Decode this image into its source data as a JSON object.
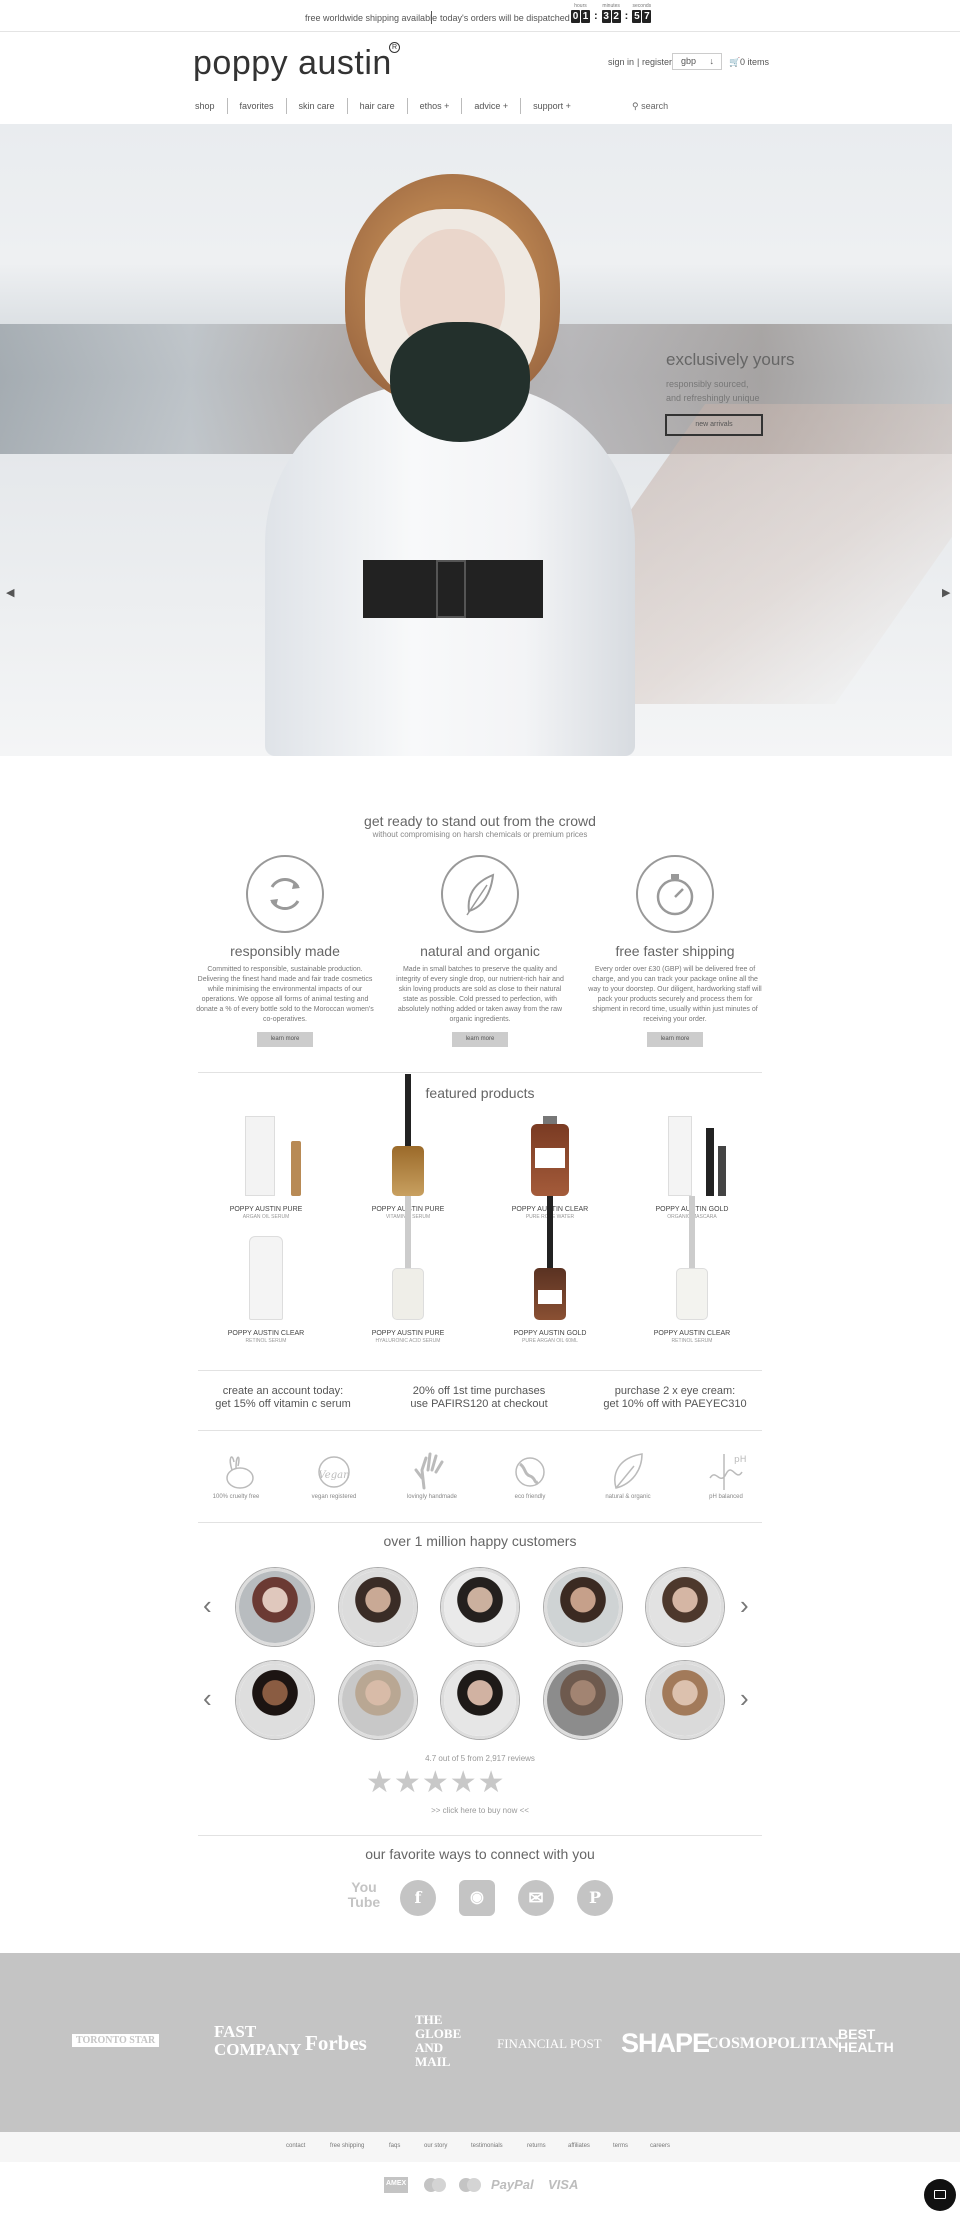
{
  "topbar": {
    "shipping": "free worldwide shipping available",
    "dispatch": "today's orders will be dispatched in",
    "timer": {
      "labels": [
        "hours",
        "minutes",
        "seconds"
      ],
      "hours": [
        "0",
        "1"
      ],
      "minutes": [
        "3",
        "2"
      ],
      "seconds": [
        "5",
        "7"
      ]
    }
  },
  "header": {
    "logo": "poppy austin",
    "reg_mark": "R",
    "sign_in": "sign in",
    "register": "register",
    "currency": "gbp",
    "cart": "0 items"
  },
  "nav": {
    "items": [
      "shop",
      "favorites",
      "skin care",
      "hair care",
      "ethos +",
      "advice +",
      "support +"
    ],
    "search": "search"
  },
  "hero": {
    "title": "exclusively yours",
    "line1": "responsibly sourced,",
    "line2": "and refreshingly unique",
    "button": "new arrivals"
  },
  "intro": {
    "title": "get ready to stand out from the crowd",
    "subtitle": "without compromising on harsh chemicals or premium prices",
    "features": [
      {
        "title": "responsibly made",
        "text": "Committed to responsible, sustainable production. Delivering the finest hand made and fair trade cosmetics while minimising the environmental impacts of our operations. We oppose all forms of animal testing and donate a % of every bottle sold to the Moroccan women's co-operatives.",
        "button": "learn more"
      },
      {
        "title": "natural and organic",
        "text": "Made in small batches to preserve the quality and integrity of every single drop, our nutrient-rich hair and skin loving products are sold as close to their natural state as possible. Cold pressed to perfection, with absolutely nothing added or taken away from the raw organic ingredients.",
        "button": "learn more"
      },
      {
        "title": "free faster shipping",
        "text": "Every order over £30 (GBP) will be delivered free of charge, and you can track your package online all the way to your doorstep. Our diligent, hardworking staff will pack your products securely and process them for shipment in record time, usually within just minutes of receiving your order.",
        "button": "learn more"
      }
    ]
  },
  "featured": {
    "title": "featured products",
    "products": [
      {
        "name": "POPPY AUSTIN PURE",
        "desc": "ARGAN OIL SERUM"
      },
      {
        "name": "POPPY AUSTIN PURE",
        "desc": "VITAMIN C SERUM"
      },
      {
        "name": "POPPY AUSTIN CLEAR",
        "desc": "PURE ROSE WATER"
      },
      {
        "name": "POPPY AUSTIN GOLD",
        "desc": "ORGANIC MASCARA"
      },
      {
        "name": "POPPY AUSTIN CLEAR",
        "desc": "RETINOL SERUM"
      },
      {
        "name": "POPPY AUSTIN PURE",
        "desc": "HYALURONIC ACID SERUM"
      },
      {
        "name": "POPPY AUSTIN GOLD",
        "desc": "PURE ARGAN OIL 60ML"
      },
      {
        "name": "POPPY AUSTIN CLEAR",
        "desc": "RETINOL SERUM"
      }
    ]
  },
  "promos": [
    {
      "line1": "create an account today:",
      "line2": "get 15% off vitamin c serum"
    },
    {
      "line1": "20% off 1st time purchases",
      "line2": "use PAFIRS120 at checkout"
    },
    {
      "line1": "purchase 2 x eye cream:",
      "line2": "get 10% off with PAEYEC310"
    }
  ],
  "badges": [
    "100% cruelty free",
    "vegan registered",
    "lovingly handmade",
    "eco friendly",
    "natural & organic",
    "pH balanced"
  ],
  "customers": {
    "title": "over 1 million happy customers",
    "reviews": "4.7 out of 5 from 2,917 reviews",
    "buy": ">> click here to buy now <<"
  },
  "connect": {
    "title": "our favorite ways to connect with you",
    "icons": [
      "youtube-icon",
      "facebook-icon",
      "instagram-icon",
      "email-icon",
      "pinterest-icon"
    ]
  },
  "press": [
    "TORONTO STAR",
    "FAST COMPANY",
    "Forbes",
    "THE GLOBE AND MAIL",
    "FINANCIAL POST",
    "SHAPE",
    "COSMOPOLITAN",
    "BEST HEALTH"
  ],
  "footer": {
    "links": [
      "contact",
      "free shipping",
      "faqs",
      "our story",
      "testimonials",
      "returns",
      "affiliates",
      "terms",
      "careers"
    ],
    "payments": [
      "AMEX",
      "MC",
      "MC",
      "PayPal",
      "VISA"
    ]
  }
}
